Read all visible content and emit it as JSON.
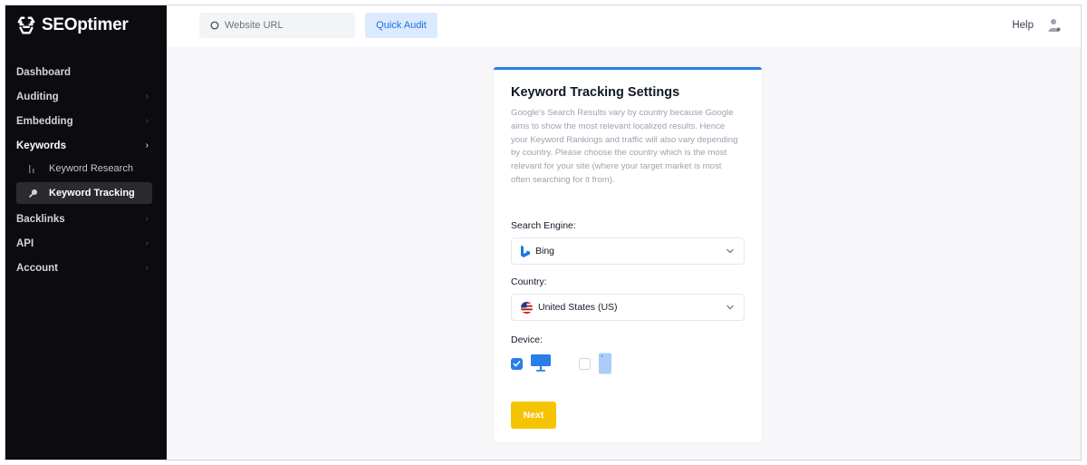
{
  "app": {
    "name": "SEOptimer"
  },
  "sidebar": {
    "items": [
      {
        "label": "Dashboard",
        "chevron": false
      },
      {
        "label": "Auditing",
        "chevron": true
      },
      {
        "label": "Embedding",
        "chevron": true
      },
      {
        "label": "Keywords",
        "chevron": true,
        "active": true,
        "children": [
          {
            "label": "Keyword Research",
            "icon": "bar-chart-icon"
          },
          {
            "label": "Keyword Tracking",
            "icon": "magnifier-icon",
            "active": true
          }
        ]
      },
      {
        "label": "Backlinks",
        "chevron": true
      },
      {
        "label": "API",
        "chevron": true
      },
      {
        "label": "Account",
        "chevron": true
      }
    ],
    "chevron_glyph": "›"
  },
  "topbar": {
    "search_placeholder": "Website URL",
    "audit_label": "Quick Audit",
    "help_label": "Help"
  },
  "card": {
    "title": "Keyword Tracking Settings",
    "description": "Google's Search Results vary by country because Google aims to show the most relevant localized results. Hence your Keyword Rankings and traffic will also vary depending by country. Please choose the country which is the most relevant for your site (where your target market is most often searching for it from).",
    "search_engine_label": "Search Engine:",
    "search_engine_value": "Bing",
    "country_label": "Country:",
    "country_value": "United States (US)",
    "device_label": "Device:",
    "devices": [
      {
        "name": "desktop",
        "checked": true
      },
      {
        "name": "mobile",
        "checked": false
      }
    ],
    "next_label": "Next"
  },
  "colors": {
    "sidebar_bg": "#0c0c10",
    "accent_blue": "#2b7de9",
    "next_yellow": "#f5c400",
    "audit_bg": "#dbeafe"
  }
}
